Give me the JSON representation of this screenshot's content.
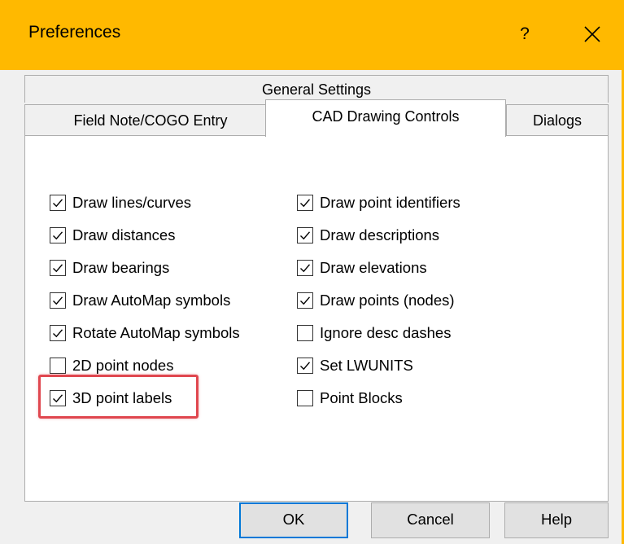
{
  "window": {
    "title": "Preferences",
    "help_label": "?",
    "close_icon": "close-icon",
    "accent_color": "#ffb900"
  },
  "tabs": {
    "general": "General Settings",
    "field_note": "Field Note/COGO Entry",
    "cad_drawing": "CAD Drawing Controls",
    "dialogs": "Dialogs",
    "active": "CAD Drawing Controls"
  },
  "options_left": [
    {
      "label": "Draw lines/curves",
      "checked": true
    },
    {
      "label": "Draw distances",
      "checked": true
    },
    {
      "label": "Draw bearings",
      "checked": true
    },
    {
      "label": "Draw AutoMap symbols",
      "checked": true
    },
    {
      "label": "Rotate AutoMap symbols",
      "checked": true
    },
    {
      "label": "2D point nodes",
      "checked": false
    },
    {
      "label": "3D point labels",
      "checked": true
    }
  ],
  "options_right": [
    {
      "label": "Draw point identifiers",
      "checked": true
    },
    {
      "label": "Draw descriptions",
      "checked": true
    },
    {
      "label": "Draw elevations",
      "checked": true
    },
    {
      "label": "Draw points (nodes)",
      "checked": true
    },
    {
      "label": "Ignore desc dashes",
      "checked": false
    },
    {
      "label": "Set LWUNITS",
      "checked": true
    },
    {
      "label": "Point Blocks",
      "checked": false
    }
  ],
  "highlight": {
    "target": "3D point labels",
    "color": "#e0474f"
  },
  "buttons": {
    "ok": "OK",
    "cancel": "Cancel",
    "help": "Help"
  }
}
